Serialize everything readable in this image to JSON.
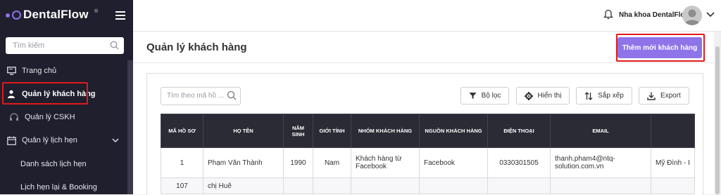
{
  "brand": {
    "name": "DentalFlow",
    "reg": "®"
  },
  "sidebar": {
    "search_placeholder": "Tìm kiếm",
    "items": [
      {
        "label": "Trang chủ"
      },
      {
        "label": "Quản lý khách hàng"
      },
      {
        "label": "Quản lý CSKH"
      },
      {
        "label": "Quản lý lịch hẹn"
      }
    ],
    "sub_items": [
      {
        "label": "Danh sách lịch hẹn"
      },
      {
        "label": "Lịch hẹn lại & Booking"
      }
    ]
  },
  "topbar": {
    "clinic_name": "Nha khoa DentalFlow"
  },
  "page": {
    "title": "Quản lý khách hàng",
    "add_button": "Thêm mới khách hàng"
  },
  "toolbar": {
    "search_placeholder": "Tìm theo mã hồ ...",
    "filter": "Bộ lọc",
    "display": "Hiển thị",
    "sort": "Sắp xếp",
    "export": "Export"
  },
  "table": {
    "headers": [
      "MÃ HỒ SƠ",
      "HỌ TÊN",
      "NĂM SINH",
      "GIỚI TÍNH",
      "NHÓM KHÁCH HÀNG",
      "NGUỒN KHÁCH HÀNG",
      "ĐIỆN THOẠI",
      "EMAIL",
      ""
    ],
    "rows": [
      [
        "1",
        "Phạm Văn Thành",
        "1990",
        "Nam",
        "Khách hàng từ Facebook",
        "Facebook",
        "0330301505",
        "thanh.pham4@ntq-solution.com.vn",
        "Mỹ Đình - I"
      ],
      [
        "107",
        "chị Huê",
        "",
        "",
        "",
        "",
        "",
        "",
        ""
      ]
    ]
  },
  "colors": {
    "accent": "#8e74e8",
    "sidebar_bg": "#1f1f2d",
    "highlight": "#e11a1a",
    "table_header": "#2b2b35"
  },
  "icons": [
    "menu-icon",
    "search-icon",
    "monitor-icon",
    "user-icon",
    "headset-icon",
    "calendar-icon",
    "chevron-down-icon",
    "bell-icon",
    "filter-icon",
    "gear-icon",
    "sort-icon",
    "download-icon"
  ]
}
